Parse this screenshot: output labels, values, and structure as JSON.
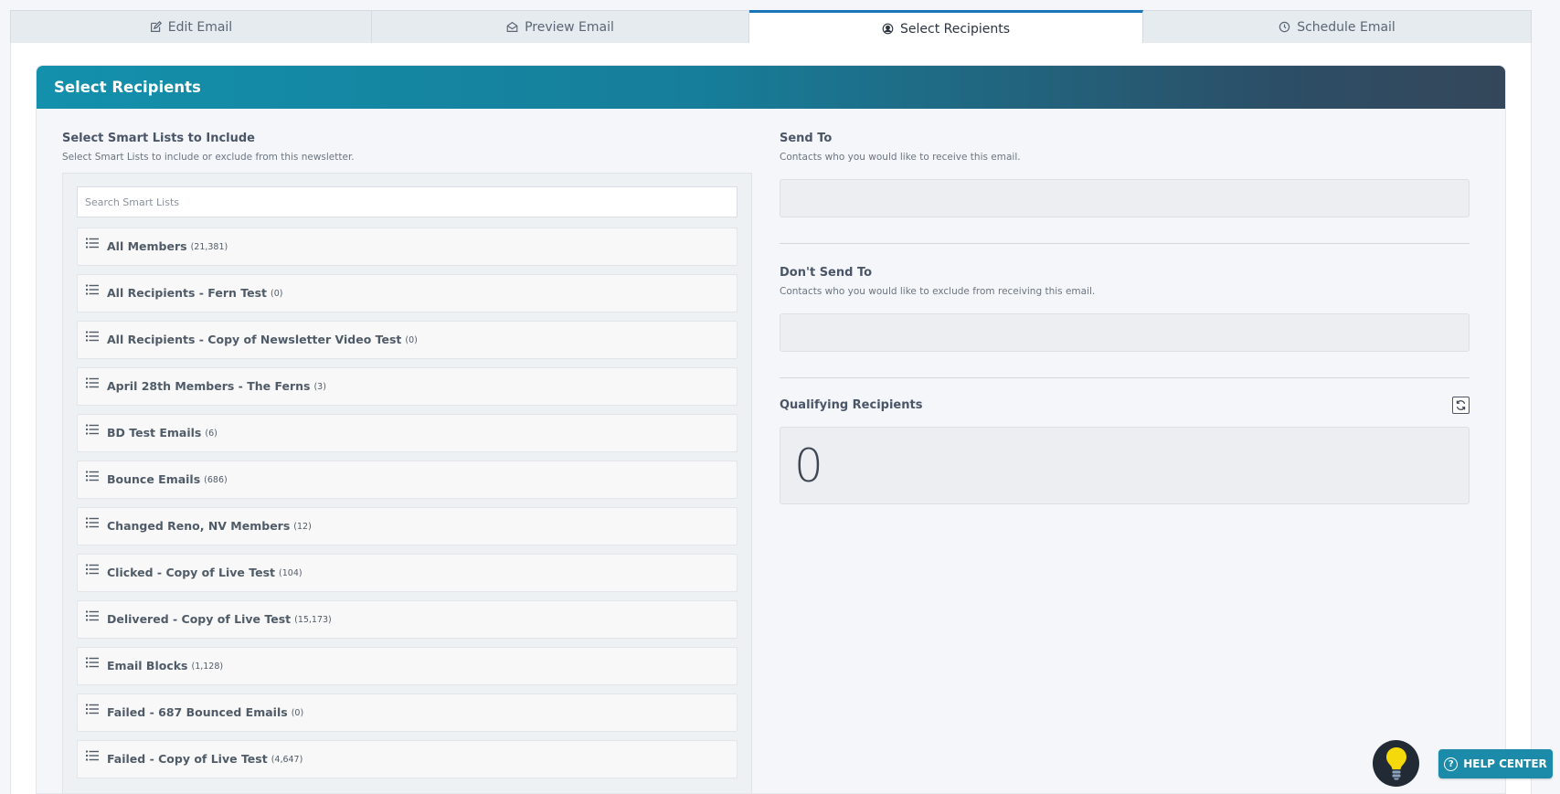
{
  "tabs": [
    {
      "label": "Edit Email",
      "icon": "edit-icon"
    },
    {
      "label": "Preview Email",
      "icon": "envelope-open-icon"
    },
    {
      "label": "Select Recipients",
      "icon": "user-circle-icon",
      "active": true
    },
    {
      "label": "Schedule Email",
      "icon": "clock-icon"
    }
  ],
  "card": {
    "title": "Select Recipients"
  },
  "smart_lists": {
    "title": "Select Smart Lists to Include",
    "description": "Select Smart Lists to include or exclude from this newsletter.",
    "search_placeholder": "Search Smart Lists",
    "items": [
      {
        "name": "All Members",
        "count": "(21,381)"
      },
      {
        "name": "All Recipients - Fern Test",
        "count": "(0)"
      },
      {
        "name": "All Recipients - Copy of Newsletter Video Test",
        "count": "(0)"
      },
      {
        "name": "April 28th Members - The Ferns",
        "count": "(3)"
      },
      {
        "name": "BD Test Emails",
        "count": "(6)"
      },
      {
        "name": "Bounce Emails",
        "count": "(686)"
      },
      {
        "name": "Changed Reno, NV Members",
        "count": "(12)"
      },
      {
        "name": "Clicked - Copy of Live Test",
        "count": "(104)"
      },
      {
        "name": "Delivered - Copy of Live Test",
        "count": "(15,173)"
      },
      {
        "name": "Email Blocks",
        "count": "(1,128)"
      },
      {
        "name": "Failed - 687 Bounced Emails",
        "count": "(0)"
      },
      {
        "name": "Failed - Copy of Live Test",
        "count": "(4,647)"
      }
    ]
  },
  "send_to": {
    "title": "Send To",
    "description": "Contacts who you would like to receive this email."
  },
  "dont_send_to": {
    "title": "Don't Send To",
    "description": "Contacts who you would like to exclude from receiving this email."
  },
  "qualifying": {
    "title": "Qualifying Recipients",
    "count": "0"
  },
  "help_center": {
    "label": "HELP CENTER"
  },
  "colors": {
    "accent": "#1a76b8",
    "header_start": "#1390ac",
    "header_end": "#35475a",
    "help_button": "#1b8ba9",
    "bulb_yellow": "#f5d90a"
  }
}
